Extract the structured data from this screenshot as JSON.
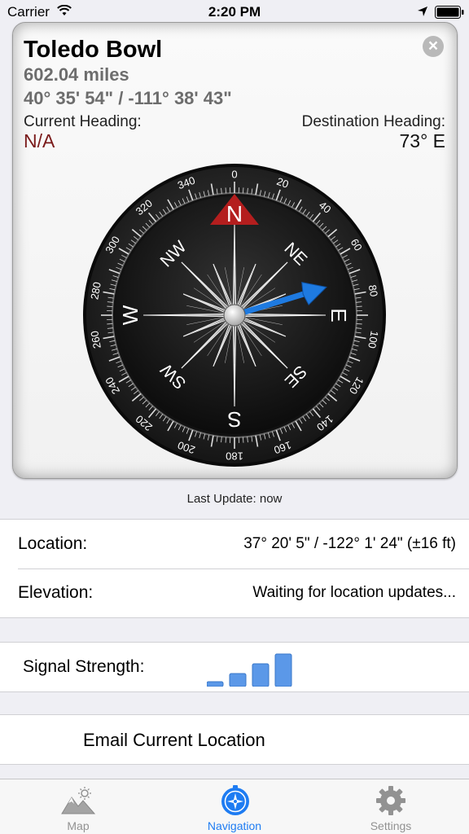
{
  "status_bar": {
    "carrier": "Carrier",
    "time": "2:20 PM"
  },
  "destination": {
    "name": "Toledo Bowl",
    "distance": "602.04 miles",
    "coordinates": "40° 35' 54\" / -111° 38' 43\"",
    "current_heading_label": "Current Heading:",
    "current_heading_value": "N/A",
    "destination_heading_label": "Destination Heading:",
    "destination_heading_value": "73° E"
  },
  "compass": {
    "bearing_deg": 73,
    "degree_labels": [
      "0",
      "20",
      "40",
      "60",
      "80",
      "100",
      "120",
      "140",
      "160",
      "180",
      "200",
      "220",
      "240",
      "260",
      "280",
      "300",
      "320",
      "340"
    ],
    "cardinals": [
      "N",
      "NE",
      "E",
      "SE",
      "S",
      "SW",
      "W",
      "NW"
    ],
    "north_marker_color": "#b41e1e",
    "needle_color": "#1e7ae0"
  },
  "last_update": "Last Update: now",
  "info": {
    "location_label": "Location:",
    "location_value": "37° 20' 5\" / -122° 1' 24\" (±16 ft)",
    "elevation_label": "Elevation:",
    "elevation_value": "Waiting for location updates..."
  },
  "signal": {
    "label": "Signal Strength:",
    "bar_color": "#5b98e8",
    "level_bars": 4
  },
  "email_button": "Email Current Location",
  "tabs": [
    {
      "label": "Map",
      "icon": "mountain-sun-icon",
      "active": false
    },
    {
      "label": "Navigation",
      "icon": "compass-icon",
      "active": true
    },
    {
      "label": "Settings",
      "icon": "gear-icon",
      "active": false
    }
  ],
  "colors": {
    "accent": "#1e7cf2",
    "inactive_tab": "#929292"
  }
}
